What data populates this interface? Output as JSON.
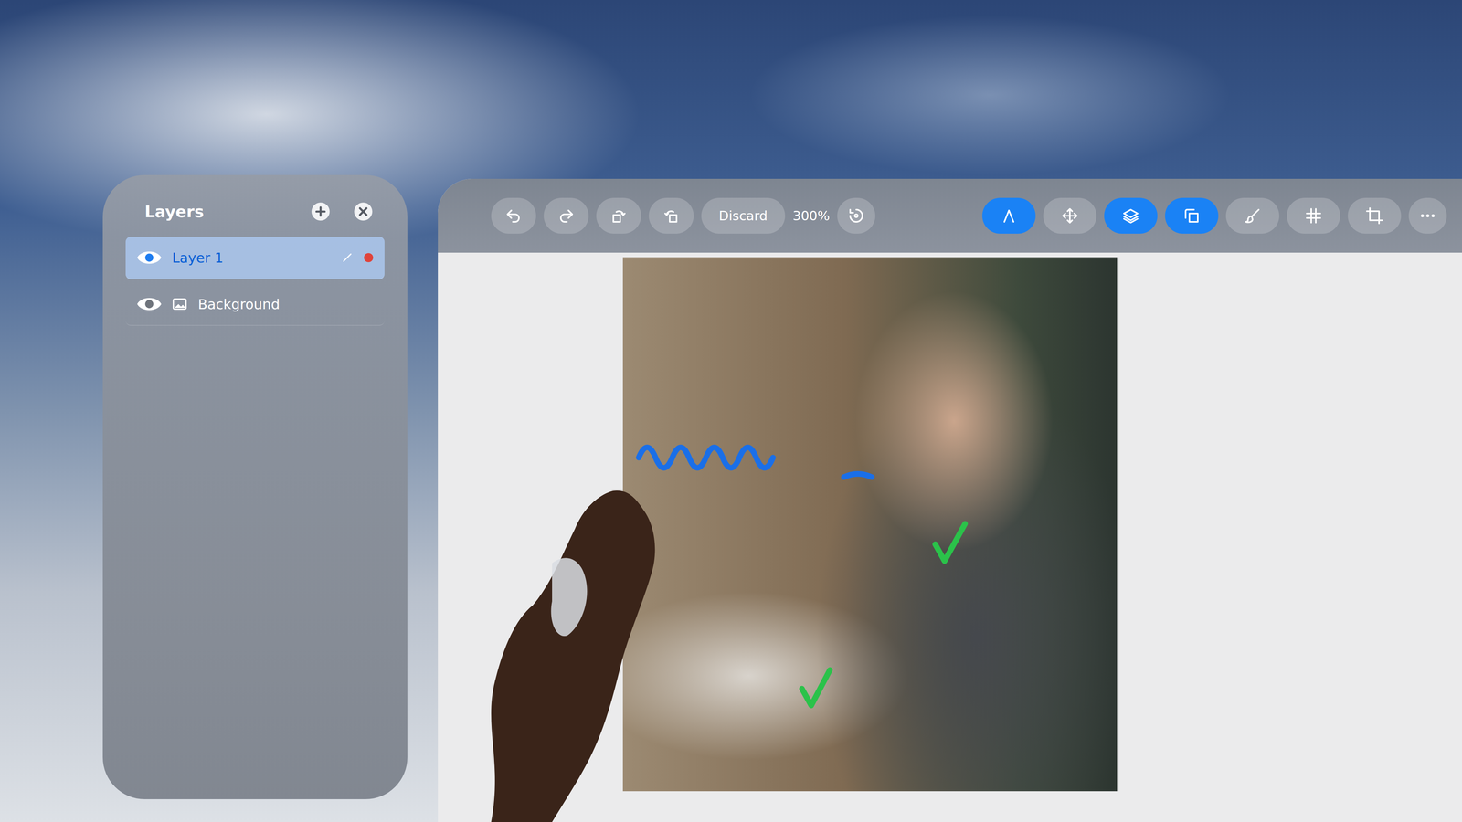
{
  "layers_panel": {
    "title": "Layers",
    "layers": [
      {
        "name": "Layer 1",
        "kind": "draw",
        "visible": true,
        "selected": true,
        "editing": true
      },
      {
        "name": "Background",
        "kind": "image",
        "visible": true,
        "selected": false,
        "editing": false
      }
    ]
  },
  "toolbar": {
    "discard": "Discard",
    "zoom": "300%",
    "tools": [
      {
        "kind": "pen",
        "selected": true
      },
      {
        "kind": "move",
        "selected": false
      },
      {
        "kind": "layers",
        "selected": true
      },
      {
        "kind": "shapes",
        "selected": true
      },
      {
        "kind": "brush",
        "selected": false
      },
      {
        "kind": "grid",
        "selected": false
      },
      {
        "kind": "crop",
        "selected": false
      }
    ]
  }
}
